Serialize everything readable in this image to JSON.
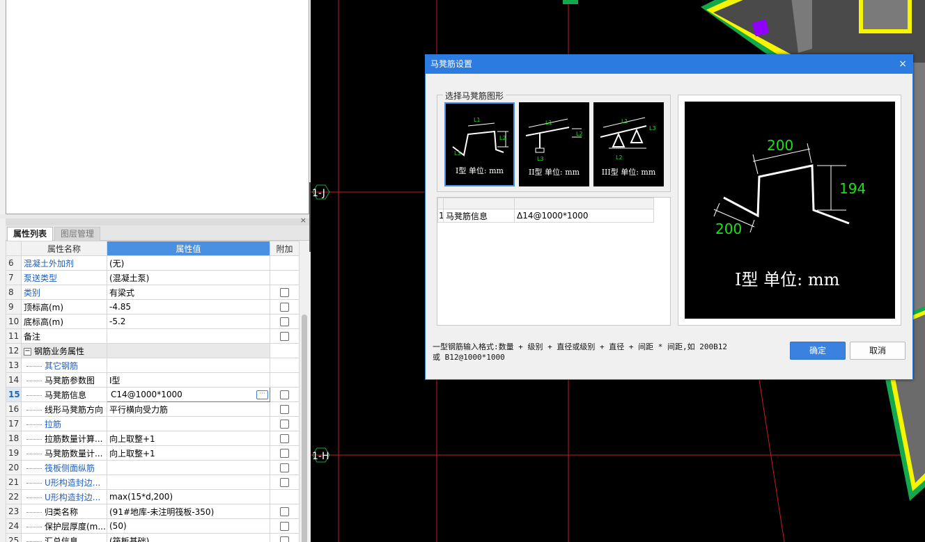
{
  "panel": {
    "close_icon": "×",
    "tabs": [
      "属性列表",
      "图层管理"
    ],
    "columns": {
      "name": "属性名称",
      "value": "属性值",
      "extra": "附加"
    },
    "rows": [
      {
        "num": "6",
        "name": "混凝土外加剂",
        "value": "(无)",
        "blue": true,
        "indent": false,
        "checkbox": false
      },
      {
        "num": "7",
        "name": "泵送类型",
        "value": "(混凝土泵)",
        "blue": true,
        "indent": false,
        "checkbox": false
      },
      {
        "num": "8",
        "name": "类别",
        "value": "有梁式",
        "blue": true,
        "indent": false,
        "checkbox": true
      },
      {
        "num": "9",
        "name": "顶标高(m)",
        "value": "-4.85",
        "blue": false,
        "indent": false,
        "checkbox": true
      },
      {
        "num": "10",
        "name": "底标高(m)",
        "value": "-5.2",
        "blue": false,
        "indent": false,
        "checkbox": true
      },
      {
        "num": "11",
        "name": "备注",
        "value": "",
        "blue": false,
        "indent": false,
        "checkbox": true
      },
      {
        "num": "12",
        "name": "钢筋业务属性",
        "value": "",
        "blue": false,
        "indent": false,
        "checkbox": false,
        "group": true,
        "expander": "−"
      },
      {
        "num": "13",
        "name": "其它钢筋",
        "value": "",
        "blue": true,
        "indent": true,
        "checkbox": false
      },
      {
        "num": "14",
        "name": "马凳筋参数图",
        "value": "I型",
        "blue": false,
        "indent": true,
        "checkbox": false
      },
      {
        "num": "15",
        "name": "马凳筋信息",
        "value": "C14@1000*1000",
        "blue": false,
        "indent": true,
        "checkbox": true,
        "editing": true,
        "selected": true
      },
      {
        "num": "16",
        "name": "线形马凳筋方向",
        "value": "平行横向受力筋",
        "blue": false,
        "indent": true,
        "checkbox": true
      },
      {
        "num": "17",
        "name": "拉筋",
        "value": "",
        "blue": true,
        "indent": true,
        "checkbox": true
      },
      {
        "num": "18",
        "name": "拉筋数量计算...",
        "value": "向上取整+1",
        "blue": false,
        "indent": true,
        "checkbox": true
      },
      {
        "num": "19",
        "name": "马凳筋数量计...",
        "value": "向上取整+1",
        "blue": false,
        "indent": true,
        "checkbox": true
      },
      {
        "num": "20",
        "name": "筏板侧面纵筋",
        "value": "",
        "blue": true,
        "indent": true,
        "checkbox": true
      },
      {
        "num": "21",
        "name": "U形构造封边...",
        "value": "",
        "blue": true,
        "indent": true,
        "checkbox": true
      },
      {
        "num": "22",
        "name": "U形构造封边...",
        "value": "max(15*d,200)",
        "blue": true,
        "indent": true,
        "checkbox": false
      },
      {
        "num": "23",
        "name": "归类名称",
        "value": "(91#地库-未注明筏板-350)",
        "blue": false,
        "indent": true,
        "checkbox": true
      },
      {
        "num": "24",
        "name": "保护层厚度(m...",
        "value": "(50)",
        "blue": false,
        "indent": true,
        "checkbox": true
      },
      {
        "num": "25",
        "name": "汇总信息",
        "value": "(筏板基础)",
        "blue": false,
        "indent": true,
        "checkbox": true
      }
    ]
  },
  "canvas": {
    "axis_labels": [
      "1-J",
      "1-H"
    ],
    "colors": {
      "grid": "#c81e1e",
      "bg": "#000000",
      "green": "#13a84b",
      "yellow": "#f5f500",
      "purple": "#8f00ff",
      "gray": "#7a7a7a"
    }
  },
  "dialog": {
    "title": "马凳筋设置",
    "close_icon": "×",
    "shape_group_label": "选择马凳筋图形",
    "shapes": [
      {
        "caption": "I型 单位: mm",
        "selected": true
      },
      {
        "caption": "II型 单位: mm",
        "selected": false
      },
      {
        "caption": "III型 单位: mm",
        "selected": false
      }
    ],
    "shape_labels": {
      "l1": "L1",
      "l2": "L2",
      "l3": "L3"
    },
    "info_row": {
      "num": "1",
      "name": "马凳筋信息",
      "value": "ⵠ14@1000*1000"
    },
    "preview": {
      "dim_top": "200",
      "dim_right": "194",
      "dim_left": "200",
      "caption": "I型 单位: mm"
    },
    "hint_line1": "一型钢筋输入格式:数量 + 级别 + 直径或级别 + 直径 + 间距 * 间距,如 200B12",
    "hint_line2": "或 B12@1000*1000",
    "ok": "确定",
    "cancel": "取消"
  }
}
